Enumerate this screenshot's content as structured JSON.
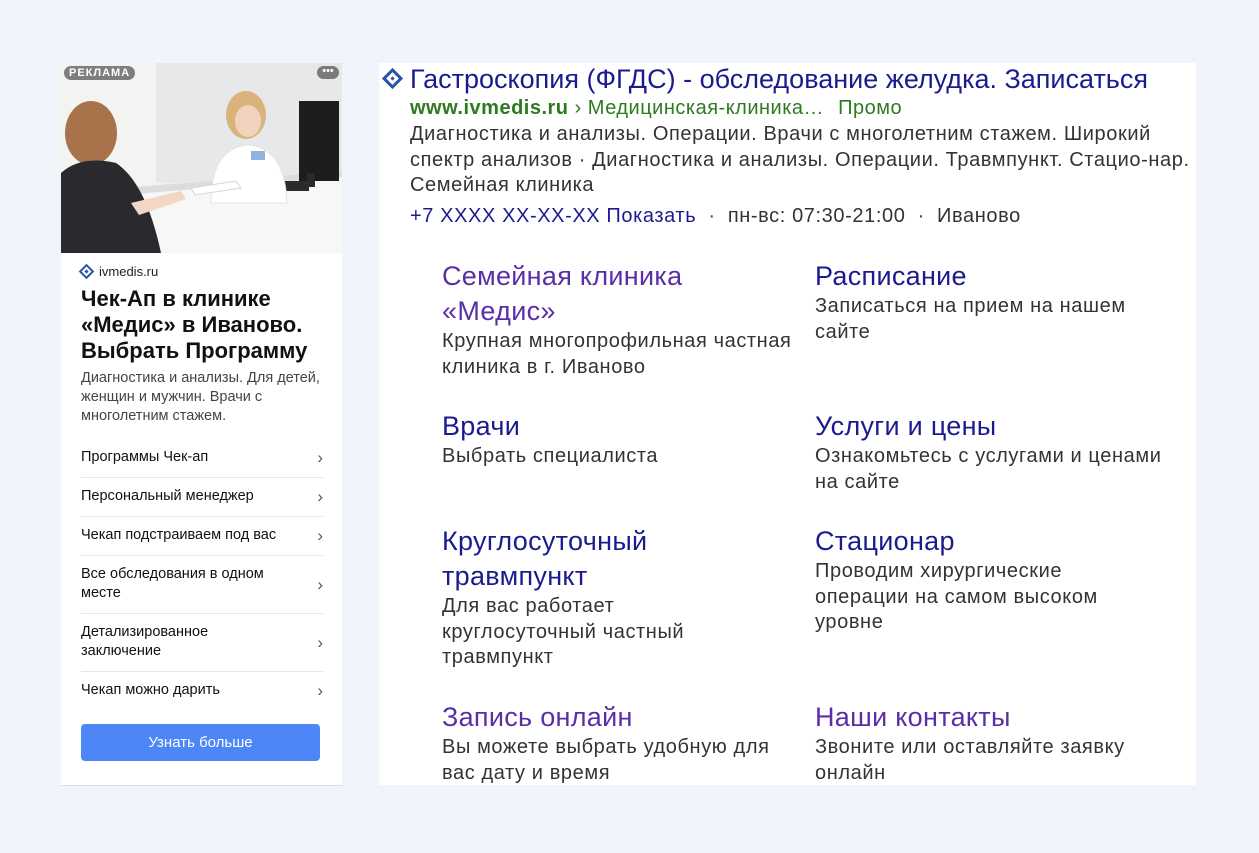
{
  "card": {
    "badge": "РЕКЛАМА",
    "menu_icon": "more-dots-icon",
    "domain": "ivmedis.ru",
    "title": "Чек-Ап в клинике «Медис» в Иваново. Выбрать Программу",
    "description": "Диагностика и анализы. Для детей, женщин и мужчин. Врачи с многолетним стажем.",
    "items": [
      {
        "label": "Программы Чек-ап"
      },
      {
        "label": "Персональный менеджер"
      },
      {
        "label": "Чекап подстраиваем под вас"
      },
      {
        "label": "Все обследования в одном месте"
      },
      {
        "label": "Детализированное заключение"
      },
      {
        "label": "Чекап можно дарить"
      }
    ],
    "button": "Узнать больше",
    "button_color": "#4d86f5"
  },
  "serp": {
    "title": "Гастроскопия (ФГДС) - обследование желудка. Записаться",
    "url_domain": "www.ivmedis.ru",
    "url_path": "› Медицинская-клиника…",
    "url_promo": "Промо",
    "description": "Диагностика и анализы. Операции. Врачи с многолетним стажем. Широкий спектр анализов · Диагностика и анализы. Операции. Травмпункт. Стацио-нар. Семейная клиника",
    "phone": "+7 XXXX XX-XX-XX Показать",
    "hours": "пн-вс: 07:30-21:00",
    "city": "Иваново",
    "sitelinks": [
      {
        "title": "Семейная клиника «Медис»",
        "desc": "Крупная многопрофильная частная клиника в г. Иваново"
      },
      {
        "title": "Расписание",
        "desc": "Записаться на прием на нашем сайте"
      },
      {
        "title": "Врачи",
        "desc": "Выбрать специалиста"
      },
      {
        "title": "Услуги и цены",
        "desc": "Ознакомьтесь с услугами и ценами на сайте"
      },
      {
        "title": "Круглосуточный травмпункт",
        "desc": "Для вас работает круглосуточный частный травмпункт"
      },
      {
        "title": "Стационар",
        "desc": "Проводим хирургические операции на самом высоком уровне"
      },
      {
        "title": "Запись онлайн",
        "desc": "Вы можете выбрать удобную для вас дату и время"
      },
      {
        "title": "Наши контакты",
        "desc": "Звоните или оставляйте заявку онлайн"
      }
    ],
    "link_color": "#1b1b8f",
    "visited_color": "#5a2ea6",
    "url_color": "#2d7a1f"
  }
}
